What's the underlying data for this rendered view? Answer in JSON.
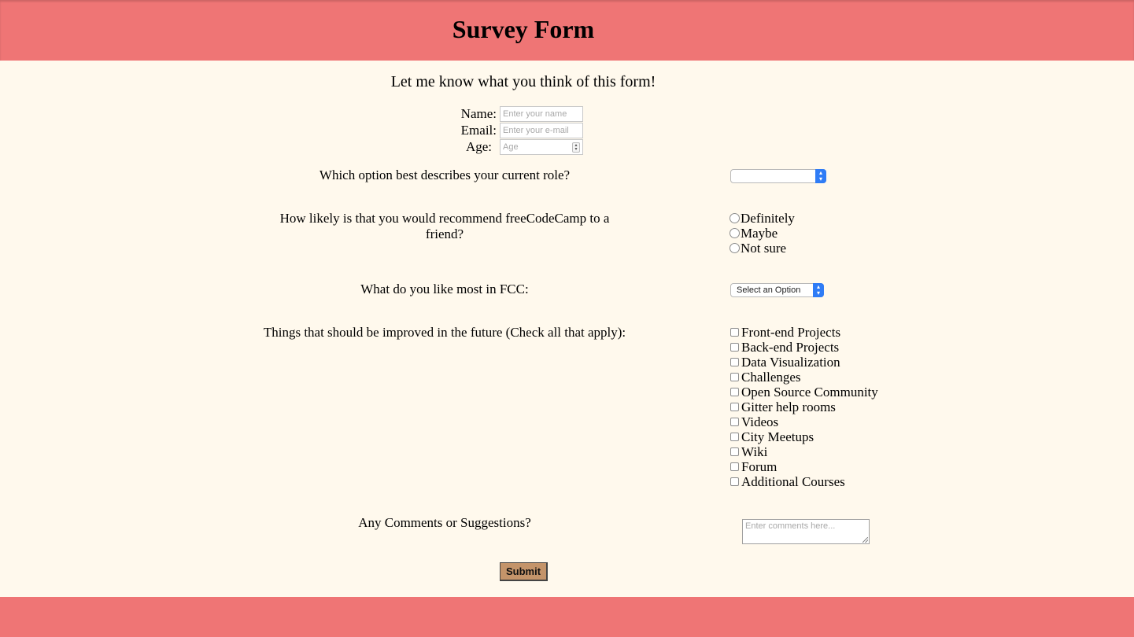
{
  "header": {
    "title": "Survey Form"
  },
  "subtitle": "Let me know what you think of this form!",
  "fields": {
    "name": {
      "label": "Name:",
      "placeholder": "Enter your name"
    },
    "email": {
      "label": "Email:",
      "placeholder": "Enter your e-mail"
    },
    "age": {
      "label": "Age:",
      "placeholder": "Age"
    }
  },
  "role": {
    "question": "Which option best describes your current role?",
    "selected": ""
  },
  "recommend": {
    "question": "How likely is that you would recommend freeCodeCamp to a friend?",
    "options": [
      "Definitely",
      "Maybe",
      "Not sure"
    ]
  },
  "like_most": {
    "question": "What do you like most in FCC:",
    "selected": "Select an Option"
  },
  "improve": {
    "question": "Things that should be improved in the future (Check all that apply):",
    "options": [
      "Front-end Projects",
      "Back-end Projects",
      "Data Visualization",
      "Challenges",
      "Open Source Community",
      "Gitter help rooms",
      "Videos",
      "City Meetups",
      "Wiki",
      "Forum",
      "Additional Courses"
    ]
  },
  "comments": {
    "question": "Any Comments or Suggestions?",
    "placeholder": "Enter comments here..."
  },
  "submit_label": "Submit",
  "colors": {
    "header_bg": "#ef7575",
    "page_bg": "#fff9ed",
    "submit_bg": "#c4946a",
    "select_accent": "#2f7cf6"
  }
}
